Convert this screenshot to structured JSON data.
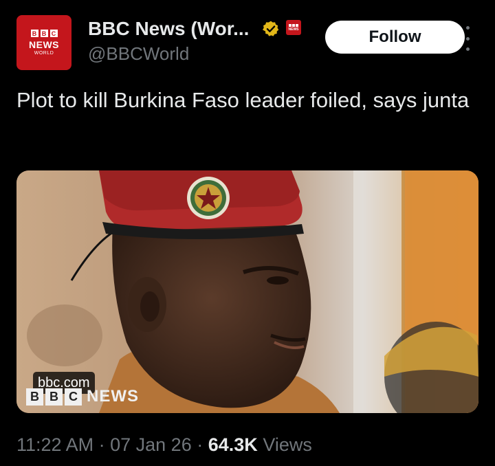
{
  "account": {
    "name": "BBC News (Wor...",
    "handle": "@BBCWorld",
    "avatar": {
      "blocks": [
        "B",
        "B",
        "C"
      ],
      "line1": "NEWS",
      "line2": "WORLD"
    },
    "verified_icon": "gold-verified-badge-icon",
    "affiliate_badge": "NEWS"
  },
  "follow_label": "Follow",
  "more_icon": "vertical-ellipsis-icon",
  "tweet_text": "Plot to kill Burkina Faso leader foiled, says junta",
  "card": {
    "domain": "bbc.com",
    "watermark_blocks": [
      "B",
      "B",
      "C"
    ],
    "watermark_text": "NEWS"
  },
  "meta": {
    "time": "11:22 AM",
    "sep": "·",
    "date": "07 Jan 26",
    "views_count": "64.3K",
    "views_label": "Views"
  },
  "colors": {
    "accent_red": "#c4161c",
    "verified_gold": "#e2b719",
    "muted": "#71767b",
    "text": "#e7e9ea"
  }
}
